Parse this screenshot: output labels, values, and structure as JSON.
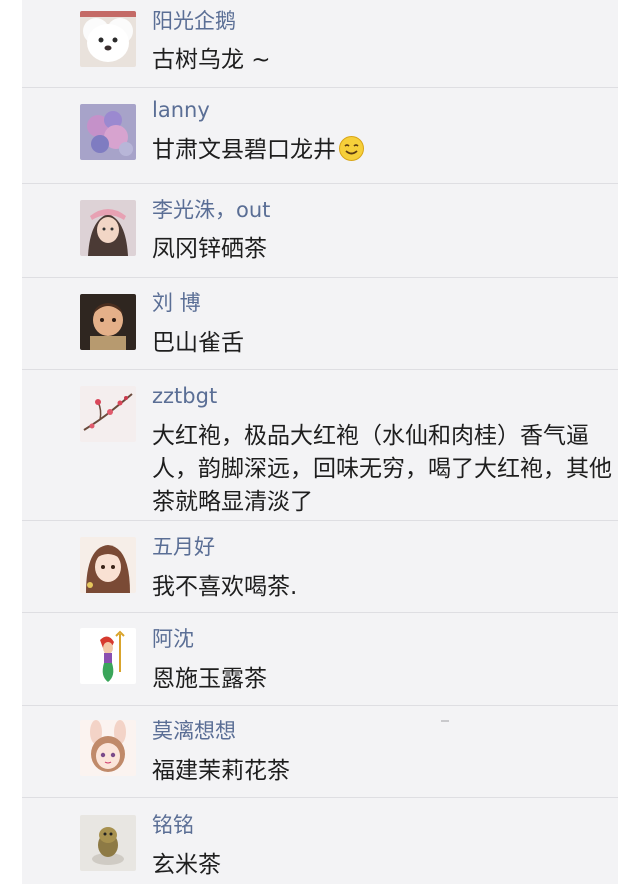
{
  "comments": [
    {
      "name": "阳光企鹅",
      "text": "古树乌龙 ~",
      "avatar": "white-dog-avatar"
    },
    {
      "name": "lanny",
      "text": "甘肃文县碧口龙井",
      "avatar": "purple-flowers-avatar",
      "emoji": "smiling-face-icon"
    },
    {
      "name": "李光洙，out",
      "text": "凤冈锌硒茶",
      "avatar": "girl-photo-avatar"
    },
    {
      "name": "刘 博",
      "text": "巴山雀舌",
      "avatar": "baby-photo-avatar"
    },
    {
      "name": "zztbgt",
      "text": "大红袍，极品大红袍（水仙和肉桂）香气逼人，韵脚深远，回味无穷，喝了大红袍，其他茶就略显清淡了",
      "avatar": "plum-blossom-avatar"
    },
    {
      "name": "五月好",
      "text": "我不喜欢喝茶.",
      "avatar": "anime-girl-avatar"
    },
    {
      "name": "阿沈",
      "text": "恩施玉露茶",
      "avatar": "mermaid-avatar"
    },
    {
      "name": "莫漓想想",
      "text": "福建茉莉花茶",
      "avatar": "bunny-girl-avatar"
    },
    {
      "name": "铭铭",
      "text": "玄米茶",
      "avatar": "toy-figure-avatar"
    }
  ],
  "colors": {
    "panel": "#f3f3f5",
    "name": "#5a6e95",
    "text": "#1e1e1e",
    "divider": "#dedee2"
  }
}
